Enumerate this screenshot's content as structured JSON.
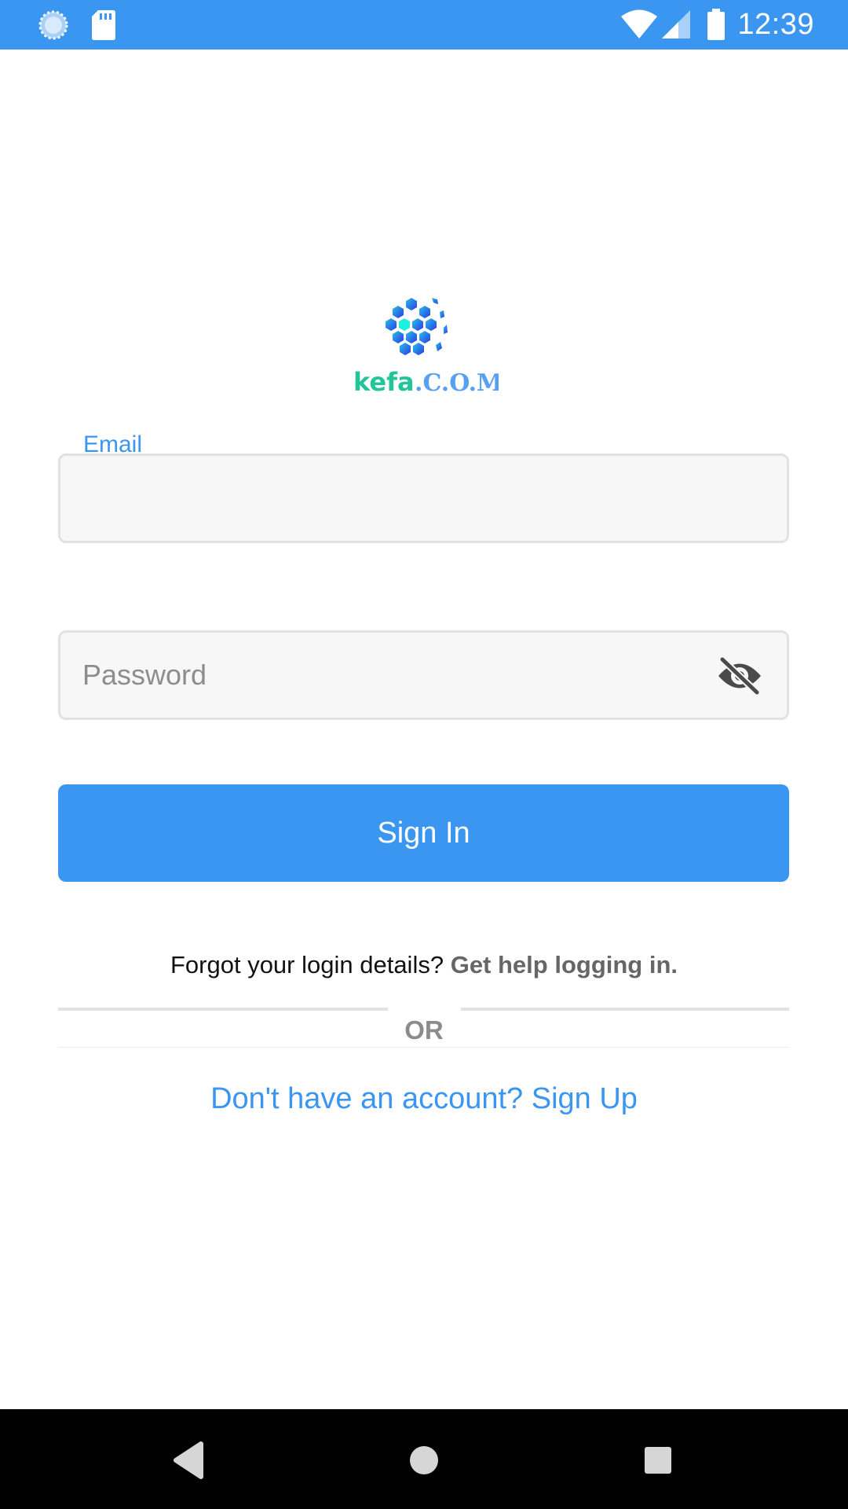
{
  "status_bar": {
    "time": "12:39",
    "background_color": "#3a96f0",
    "icons": [
      "sync-icon",
      "sd-card-icon",
      "wifi-icon",
      "signal-icon",
      "battery-icon"
    ]
  },
  "logo": {
    "text_part1": "kefa",
    "text_part2": ".C.O.M",
    "icon": "soccer-ball-icon"
  },
  "form": {
    "email_label": "Email",
    "email_value": "",
    "password_placeholder": "Password",
    "password_value": "",
    "password_toggle_icon": "eye-off-icon"
  },
  "actions": {
    "sign_in_label": "Sign In",
    "forgot_text": "Forgot your login details?",
    "help_link": "Get help logging in.",
    "divider_text": "OR",
    "signup_text": "Don't have an account? Sign Up"
  },
  "nav_bar": {
    "buttons": [
      "back-icon",
      "home-icon",
      "recents-icon"
    ]
  },
  "colors": {
    "accent": "#3a96f0",
    "field_bg": "#f7f7f7",
    "field_border": "#e2e2e2"
  }
}
